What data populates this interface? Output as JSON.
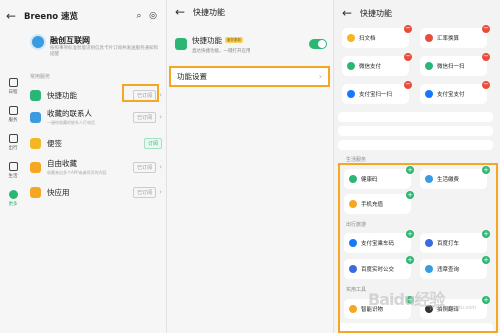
{
  "panel1": {
    "title": "Breeno 速览",
    "brand_name": "融创互联网",
    "brand_desc": "按照事项标准智能识别信息卡片订阅并发送服务通知和提醒",
    "section_label": "常用服务",
    "rail": [
      {
        "label": "日程",
        "icon": "calendar-icon"
      },
      {
        "label": "服务",
        "icon": "service-icon"
      },
      {
        "label": "出行",
        "icon": "travel-icon"
      },
      {
        "label": "生活",
        "icon": "life-icon"
      },
      {
        "label": "更多",
        "icon": "more-icon"
      }
    ],
    "services": [
      {
        "label": "快捷功能",
        "sub": "",
        "status": "已订阅",
        "color": "#2bb673"
      },
      {
        "label": "收藏的联系人",
        "sub": "一键给收藏的联系人打电话",
        "status": "已订阅",
        "color": "#3a9be0"
      },
      {
        "label": "便签",
        "sub": "",
        "status": "订阅",
        "color": "#f5b623"
      },
      {
        "label": "自由收藏",
        "sub": "收藏来自多个APP或者网页的内容",
        "status": "已订阅",
        "color": "#f5a623"
      },
      {
        "label": "快应用",
        "sub": "",
        "status": "已订阅",
        "color": "#f5a623"
      }
    ]
  },
  "panel2": {
    "title": "快捷功能",
    "card_title": "快捷功能",
    "card_tag": "服务更新",
    "card_desc": "直达快捷功能，一键打开应用",
    "toggle_on": true,
    "settings_label": "功能设置"
  },
  "panel3": {
    "title": "快捷功能",
    "added_tiles": [
      {
        "label": "扫文档",
        "color": "#f5b623"
      },
      {
        "label": "汇率换算",
        "color": "#e84c3d"
      },
      {
        "label": "微信支付",
        "color": "#2bb673"
      },
      {
        "label": "微信扫一扫",
        "color": "#2bb673"
      },
      {
        "label": "支付宝扫一扫",
        "color": "#1677ff"
      },
      {
        "label": "支付宝支付",
        "color": "#1677ff"
      }
    ],
    "sections": [
      {
        "label": "生活服务",
        "tiles": [
          {
            "label": "健康码",
            "color": "#2bb673"
          },
          {
            "label": "生活缴费",
            "color": "#3a9be0"
          },
          {
            "label": "手机充值",
            "color": "#f5a623"
          }
        ]
      },
      {
        "label": "出行旅游",
        "tiles": [
          {
            "label": "支付宝乘车码",
            "color": "#1677ff"
          },
          {
            "label": "百度打车",
            "color": "#3a6be0"
          },
          {
            "label": "百度实时公交",
            "color": "#3a6be0"
          },
          {
            "label": "违章查询",
            "color": "#3a9be0"
          }
        ]
      },
      {
        "label": "实用工具",
        "tiles": [
          {
            "label": "智能识物",
            "color": "#f5a623"
          },
          {
            "label": "拍照翻译",
            "color": "#333333"
          }
        ]
      }
    ],
    "watermark": "Baidu经验",
    "watermark_sub": "jingyan.baidu.com"
  }
}
